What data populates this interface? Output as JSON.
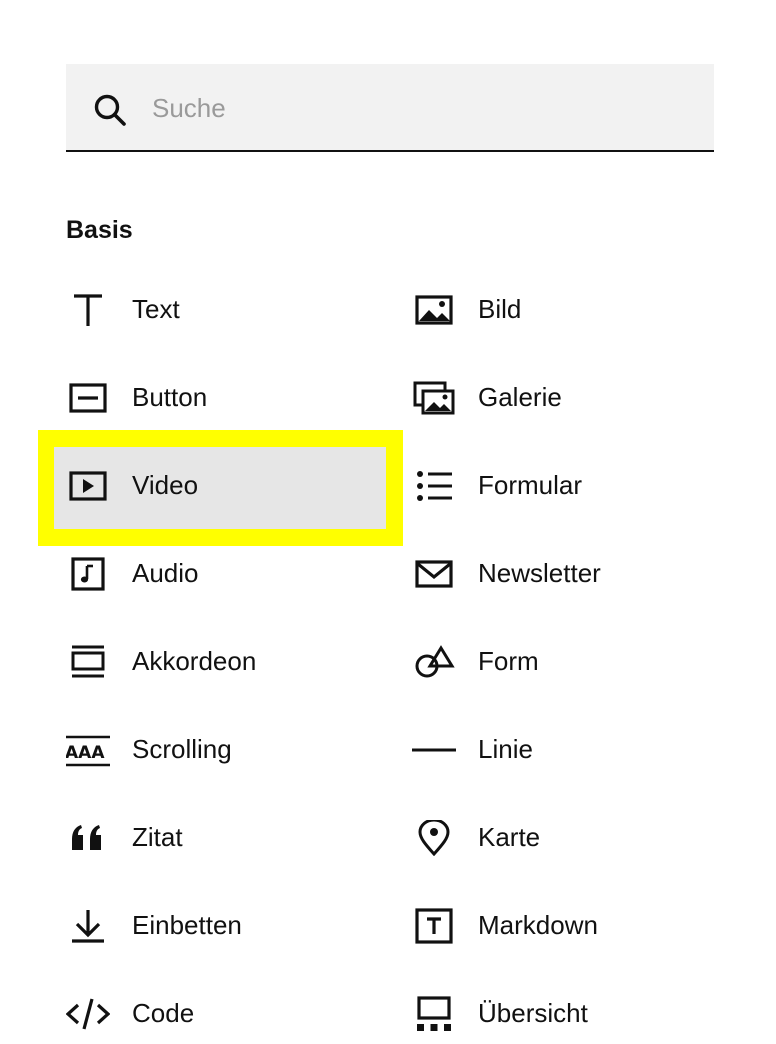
{
  "search": {
    "placeholder": "Suche",
    "value": ""
  },
  "section": {
    "title": "Basis"
  },
  "highlight": {
    "color": "#ffff00",
    "selected_item": "Video"
  },
  "left_items": [
    {
      "label": "Text",
      "icon": "text-icon"
    },
    {
      "label": "Button",
      "icon": "button-icon"
    },
    {
      "label": "Video",
      "icon": "video-icon"
    },
    {
      "label": "Audio",
      "icon": "audio-icon"
    },
    {
      "label": "Akkordeon",
      "icon": "accordion-icon"
    },
    {
      "label": "Scrolling",
      "icon": "scrolling-icon"
    },
    {
      "label": "Zitat",
      "icon": "quote-icon"
    },
    {
      "label": "Einbetten",
      "icon": "embed-icon"
    },
    {
      "label": "Code",
      "icon": "code-icon"
    }
  ],
  "right_items": [
    {
      "label": "Bild",
      "icon": "image-icon"
    },
    {
      "label": "Galerie",
      "icon": "gallery-icon"
    },
    {
      "label": "Formular",
      "icon": "form-list-icon"
    },
    {
      "label": "Newsletter",
      "icon": "envelope-icon"
    },
    {
      "label": "Form",
      "icon": "shapes-icon"
    },
    {
      "label": "Linie",
      "icon": "line-icon"
    },
    {
      "label": "Karte",
      "icon": "map-pin-icon"
    },
    {
      "label": "Markdown",
      "icon": "markdown-icon"
    },
    {
      "label": "Übersicht",
      "icon": "summary-icon"
    }
  ]
}
